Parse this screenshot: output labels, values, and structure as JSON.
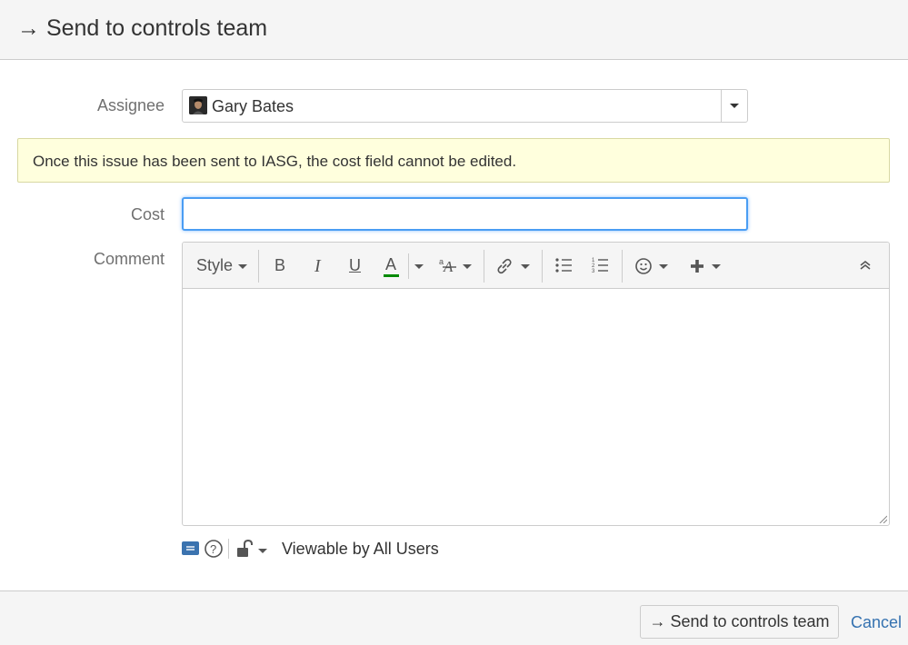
{
  "dialog": {
    "title": "→ Send to controls team"
  },
  "assignee": {
    "label": "Assignee",
    "value": "Gary Bates"
  },
  "warning": {
    "message": "Once this issue has been sent to IASG, the cost field cannot be edited."
  },
  "cost": {
    "label": "Cost",
    "value": ""
  },
  "comment": {
    "label": "Comment",
    "toolbar": {
      "style_label": "Style",
      "bold_glyph": "B",
      "italic_glyph": "I",
      "underline_glyph": "U",
      "text_color_glyph": "A",
      "text_color_accent": "#008a00",
      "icons": [
        "format-more-icon",
        "link-icon",
        "bullet-list-icon",
        "numbered-list-icon",
        "emoticon-icon",
        "insert-icon",
        "collapse-toolbar-icon"
      ]
    },
    "visibility": {
      "text": "Viewable by All Users",
      "icons": [
        "editor-mode-icon",
        "help-icon",
        "unlock-icon"
      ]
    }
  },
  "footer": {
    "submit_label": "→ Send to controls team",
    "cancel_label": "Cancel"
  },
  "colors": {
    "focus": "#4a9df3",
    "warning_bg": "#ffffdd",
    "link": "#3572b0"
  }
}
